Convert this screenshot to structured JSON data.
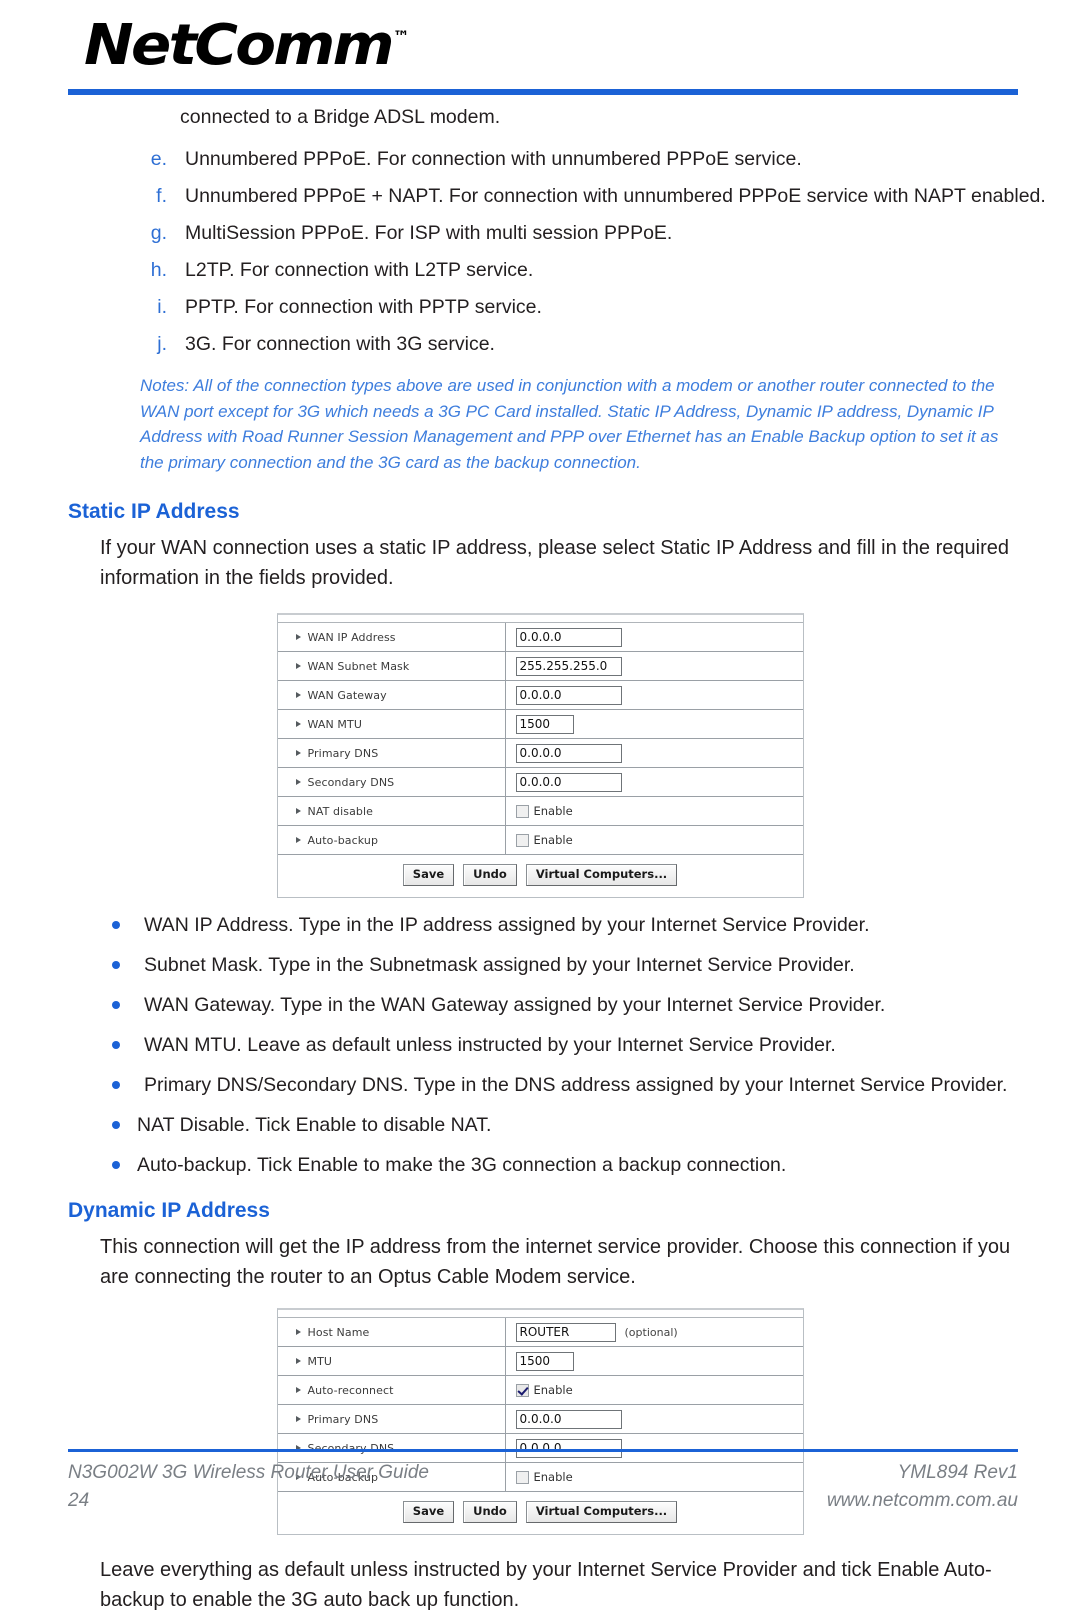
{
  "brand": {
    "logo_text": "NetComm",
    "logo_tm": "™"
  },
  "intro": {
    "continuation_line": "connected to a Bridge ADSL modem."
  },
  "connection_types": [
    {
      "marker": "e.",
      "text": "Unnumbered PPPoE. For connection with unnumbered PPPoE service."
    },
    {
      "marker": "f.",
      "text": "Unnumbered PPPoE + NAPT. For connection with unnumbered PPPoE service with NAPT enabled."
    },
    {
      "marker": "g.",
      "text": "MultiSession PPPoE. For ISP with multi session PPPoE."
    },
    {
      "marker": "h.",
      "text": "L2TP. For connection with L2TP service."
    },
    {
      "marker": "i.",
      "text": "PPTP. For connection with PPTP service."
    },
    {
      "marker": "j.",
      "text": "3G. For connection with 3G service."
    }
  ],
  "notes": {
    "text": "Notes: All of the connection types above are used in conjunction with a modem or another router connected to the WAN port except for 3G which needs a 3G PC Card installed. Static IP Address, Dynamic IP address, Dynamic IP Address with Road Runner Session Management and PPP over Ethernet has an Enable Backup option to set it as the primary connection and the 3G card as the backup connection."
  },
  "static_ip": {
    "heading": "Static IP Address",
    "intro": "If your WAN connection uses a static IP address, please select Static IP Address and fill in the required information in the fields provided.",
    "form": {
      "rows": [
        {
          "label": "WAN IP Address",
          "type": "text",
          "value": "0.0.0.0",
          "width": "w-ip"
        },
        {
          "label": "WAN Subnet Mask",
          "type": "text",
          "value": "255.255.255.0",
          "width": "w-ip"
        },
        {
          "label": "WAN Gateway",
          "type": "text",
          "value": "0.0.0.0",
          "width": "w-ip"
        },
        {
          "label": "WAN MTU",
          "type": "text",
          "value": "1500",
          "width": "w-mtu"
        },
        {
          "label": "Primary DNS",
          "type": "text",
          "value": "0.0.0.0",
          "width": "w-ip"
        },
        {
          "label": "Secondary DNS",
          "type": "text",
          "value": "0.0.0.0",
          "width": "w-ip"
        },
        {
          "label": "NAT disable",
          "type": "checkbox",
          "checkbox_label": "Enable",
          "checked": false
        },
        {
          "label": "Auto-backup",
          "type": "checkbox",
          "checkbox_label": "Enable",
          "checked": false
        }
      ],
      "buttons": [
        {
          "label": "Save"
        },
        {
          "label": "Undo"
        },
        {
          "label": "Virtual Computers..."
        }
      ]
    },
    "bullets": [
      {
        "text": "WAN IP Address. Type in the IP address assigned by your Internet Service Provider.",
        "tight": false
      },
      {
        "text": "Subnet Mask. Type in the Subnetmask assigned by your Internet Service Provider.",
        "tight": false
      },
      {
        "text": "WAN Gateway. Type in the WAN Gateway assigned by your Internet Service Provider.",
        "tight": false
      },
      {
        "text": "WAN MTU. Leave as default unless instructed by your Internet Service Provider.",
        "tight": false
      },
      {
        "text": "Primary DNS/Secondary DNS. Type in the DNS address assigned by your Internet Service Provider.",
        "tight": false
      },
      {
        "text": "NAT Disable. Tick Enable to disable NAT.",
        "tight": true
      },
      {
        "text": "Auto-backup. Tick Enable to make the 3G connection a backup connection.",
        "tight": true
      }
    ]
  },
  "dynamic_ip": {
    "heading": "Dynamic IP Address",
    "intro": "This connection will get the IP address from the internet service provider. Choose this connection if you are connecting the router to an Optus Cable Modem service.",
    "form": {
      "rows": [
        {
          "label": "Host Name",
          "type": "text",
          "value": "ROUTER",
          "width": "w-host",
          "suffix": "(optional)"
        },
        {
          "label": "MTU",
          "type": "text",
          "value": "1500",
          "width": "w-mtu"
        },
        {
          "label": "Auto-reconnect",
          "type": "checkbox",
          "checkbox_label": "Enable",
          "checked": true
        },
        {
          "label": "Primary DNS",
          "type": "text",
          "value": "0.0.0.0",
          "width": "w-ip"
        },
        {
          "label": "Secondary DNS",
          "type": "text",
          "value": "0.0.0.0",
          "width": "w-ip"
        },
        {
          "label": "Auto-backup",
          "type": "checkbox",
          "checkbox_label": "Enable",
          "checked": false
        }
      ],
      "buttons": [
        {
          "label": "Save"
        },
        {
          "label": "Undo"
        },
        {
          "label": "Virtual Computers..."
        }
      ]
    },
    "closing": "Leave everything as default unless instructed by your Internet Service Provider and tick Enable Auto-backup to enable the 3G auto back up function."
  },
  "footer": {
    "doc_title": "N3G002W 3G Wireless Router User Guide",
    "page_number": "24",
    "revision": "YML894 Rev1",
    "website": "www.netcomm.com.au"
  },
  "colors": {
    "accent_blue": "#1b62d6",
    "note_blue": "#3d7ddd",
    "body_text": "#231f20",
    "footer_gray": "#7a7f85"
  }
}
